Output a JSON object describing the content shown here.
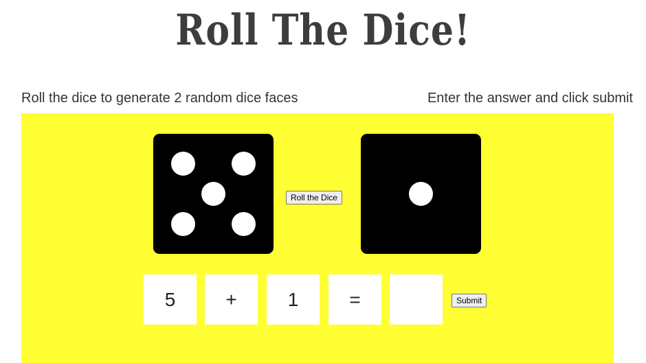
{
  "title": "Roll The Dice!",
  "instructions": {
    "left": "Roll the dice to generate 2 random dice faces",
    "right": "Enter the answer and click submit"
  },
  "dice": {
    "left_value": 5,
    "right_value": 1,
    "face_color": "#000000",
    "pip_color": "#ffffff"
  },
  "roll_button_label": "Roll the Dice",
  "equation": {
    "operand1": "5",
    "operator": "+",
    "operand2": "1",
    "equals": "=",
    "answer": ""
  },
  "submit_button_label": "Submit",
  "colors": {
    "board": "#ffff33",
    "title": "#3d3d3d"
  }
}
